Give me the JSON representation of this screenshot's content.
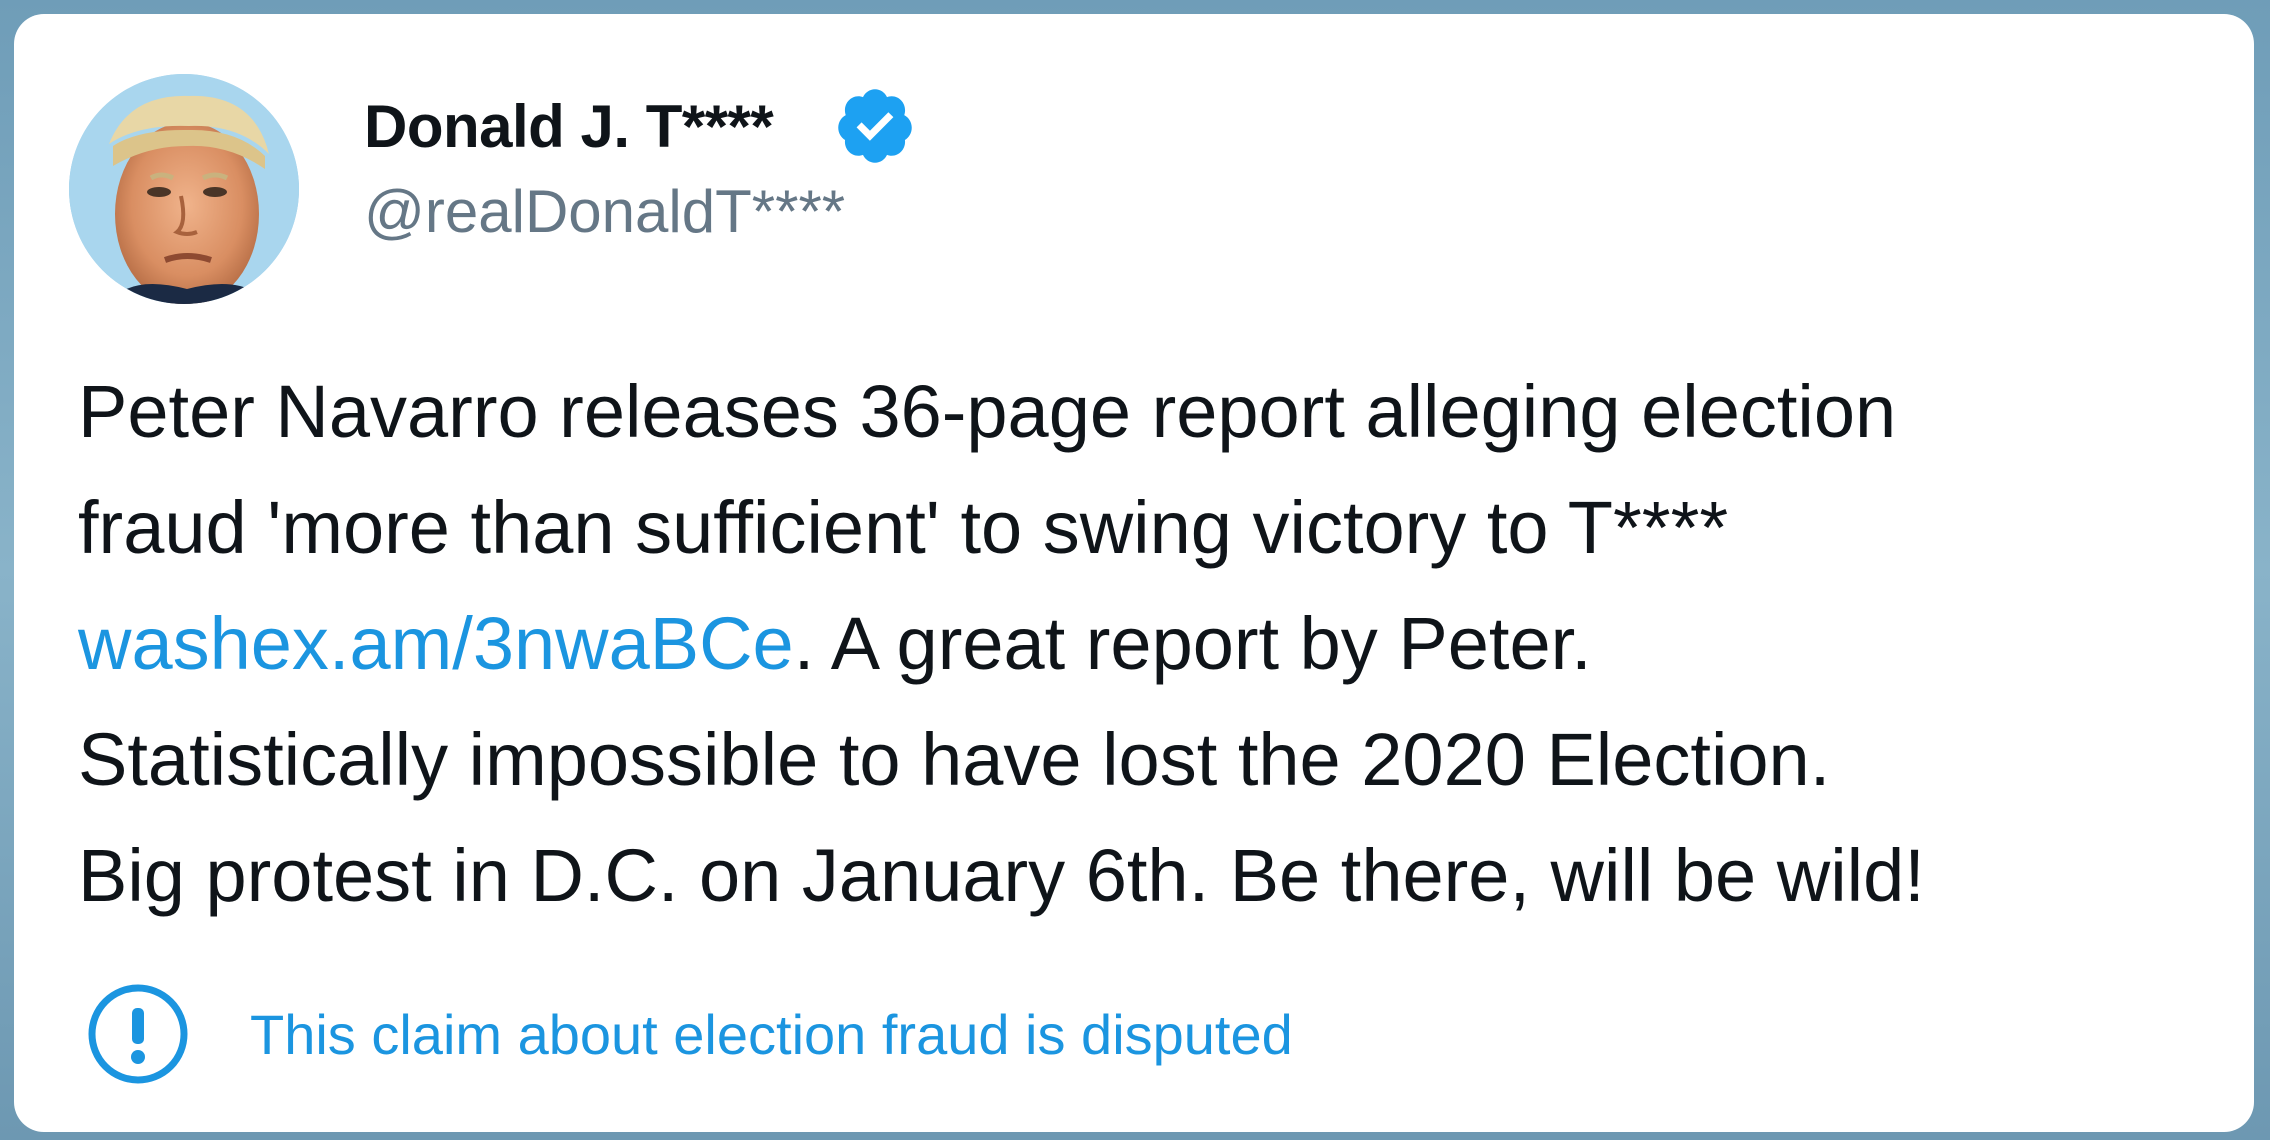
{
  "tweet": {
    "display_name": "Donald J. T****",
    "handle": "@realDonaldT****",
    "verified_icon": "verified-badge-icon",
    "avatar_icon": "profile-avatar",
    "text": {
      "line1": "Peter Navarro releases 36-page report alleging election",
      "line2": "fraud 'more than sufficient' to swing victory to T****",
      "link": "washex.am/3nwaBCe",
      "line3_rest": ". A great report by Peter.",
      "line4": "Statistically impossible to have lost the 2020 Election.",
      "line5": "Big protest in D.C. on January 6th. Be there, will be wild!"
    },
    "notice": {
      "icon": "exclamation-circle-icon",
      "text": "This claim about election fraud is disputed"
    }
  },
  "colors": {
    "link": "#1b95e0",
    "verified": "#1da1f2",
    "text": "#0f1419",
    "handle": "#657786",
    "backdrop": "#7aa6bf"
  }
}
